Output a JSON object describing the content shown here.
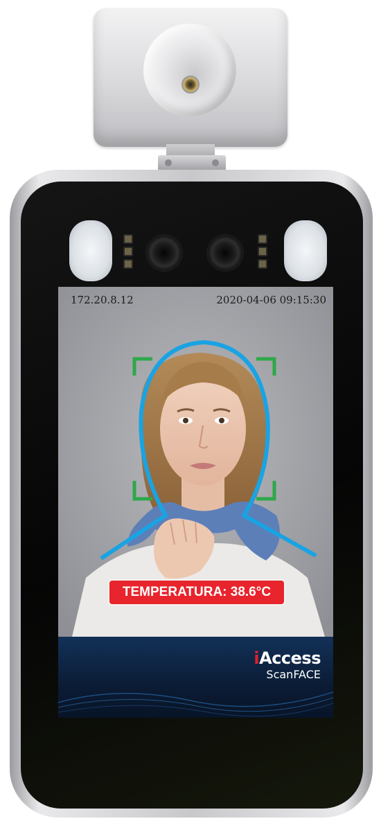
{
  "screen": {
    "ip_address": "172.20.8.12",
    "datetime": "2020-04-06 09:15:30",
    "temperature_label": "TEMPERATURA: 38.6°C"
  },
  "brand": {
    "prefix": "i",
    "name": "Access",
    "product": "ScanFACE"
  },
  "colors": {
    "alert_red": "#e8242c",
    "face_outline": "#1aa3e3",
    "face_bracket": "#2ea84a",
    "brand_blue": "#0b1c35"
  }
}
